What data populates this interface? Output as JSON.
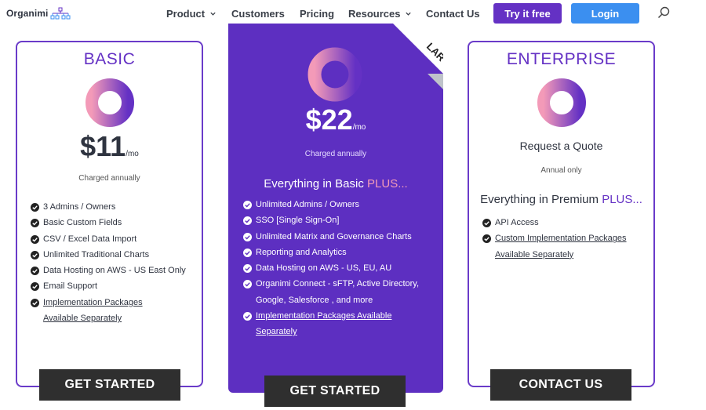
{
  "nav": {
    "brand": "Organimi",
    "menu": [
      {
        "label": "Product",
        "has_caret": true
      },
      {
        "label": "Customers",
        "has_caret": false
      },
      {
        "label": "Pricing",
        "has_caret": false
      },
      {
        "label": "Resources",
        "has_caret": true
      },
      {
        "label": "Contact Us",
        "has_caret": false
      }
    ],
    "try_label": "Try it free",
    "login_label": "Login",
    "search_icon": "search-icon"
  },
  "colors": {
    "brand_purple": "#6431c4",
    "premium_bg": "#5d2fc1",
    "login_blue": "#3b8ff0",
    "cta_dark": "#2f2f2f",
    "accent_pink": "#f39ab8"
  },
  "plans": {
    "basic": {
      "title": "BASIC",
      "price": "$11",
      "per": "/mo",
      "billing": "Charged annually",
      "features": [
        "3 Admins / Owners",
        "Basic Custom Fields",
        "CSV / Excel Data Import",
        "Unlimited Traditional Charts",
        "Data Hosting on AWS - US East Only",
        "Email Support",
        "Implementation Packages Available Separately"
      ],
      "cta": "GET STARTED"
    },
    "premium": {
      "ribbon": "LAR",
      "price": "$22",
      "per": "/mo",
      "billing": "Charged annually",
      "heading": "Everything in Basic",
      "heading_plus": "PLUS...",
      "features": [
        "Unlimited Admins / Owners",
        "SSO [Single Sign-On]",
        "Unlimited Matrix and Governance Charts",
        "Reporting and Analytics",
        "Data Hosting on AWS - US, EU, AU",
        "Organimi Connect - sFTP, Active Directory, Google, Salesforce , and more",
        "Implementation Packages Available Separately"
      ],
      "cta": "GET STARTED"
    },
    "enterprise": {
      "title": "ENTERPRISE",
      "quote": "Request a Quote",
      "billing": "Annual only",
      "heading": "Everything in Premium",
      "heading_plus": "PLUS...",
      "features": [
        "API Access",
        "Custom Implementation Packages Available Separately"
      ],
      "cta": "CONTACT US"
    }
  }
}
